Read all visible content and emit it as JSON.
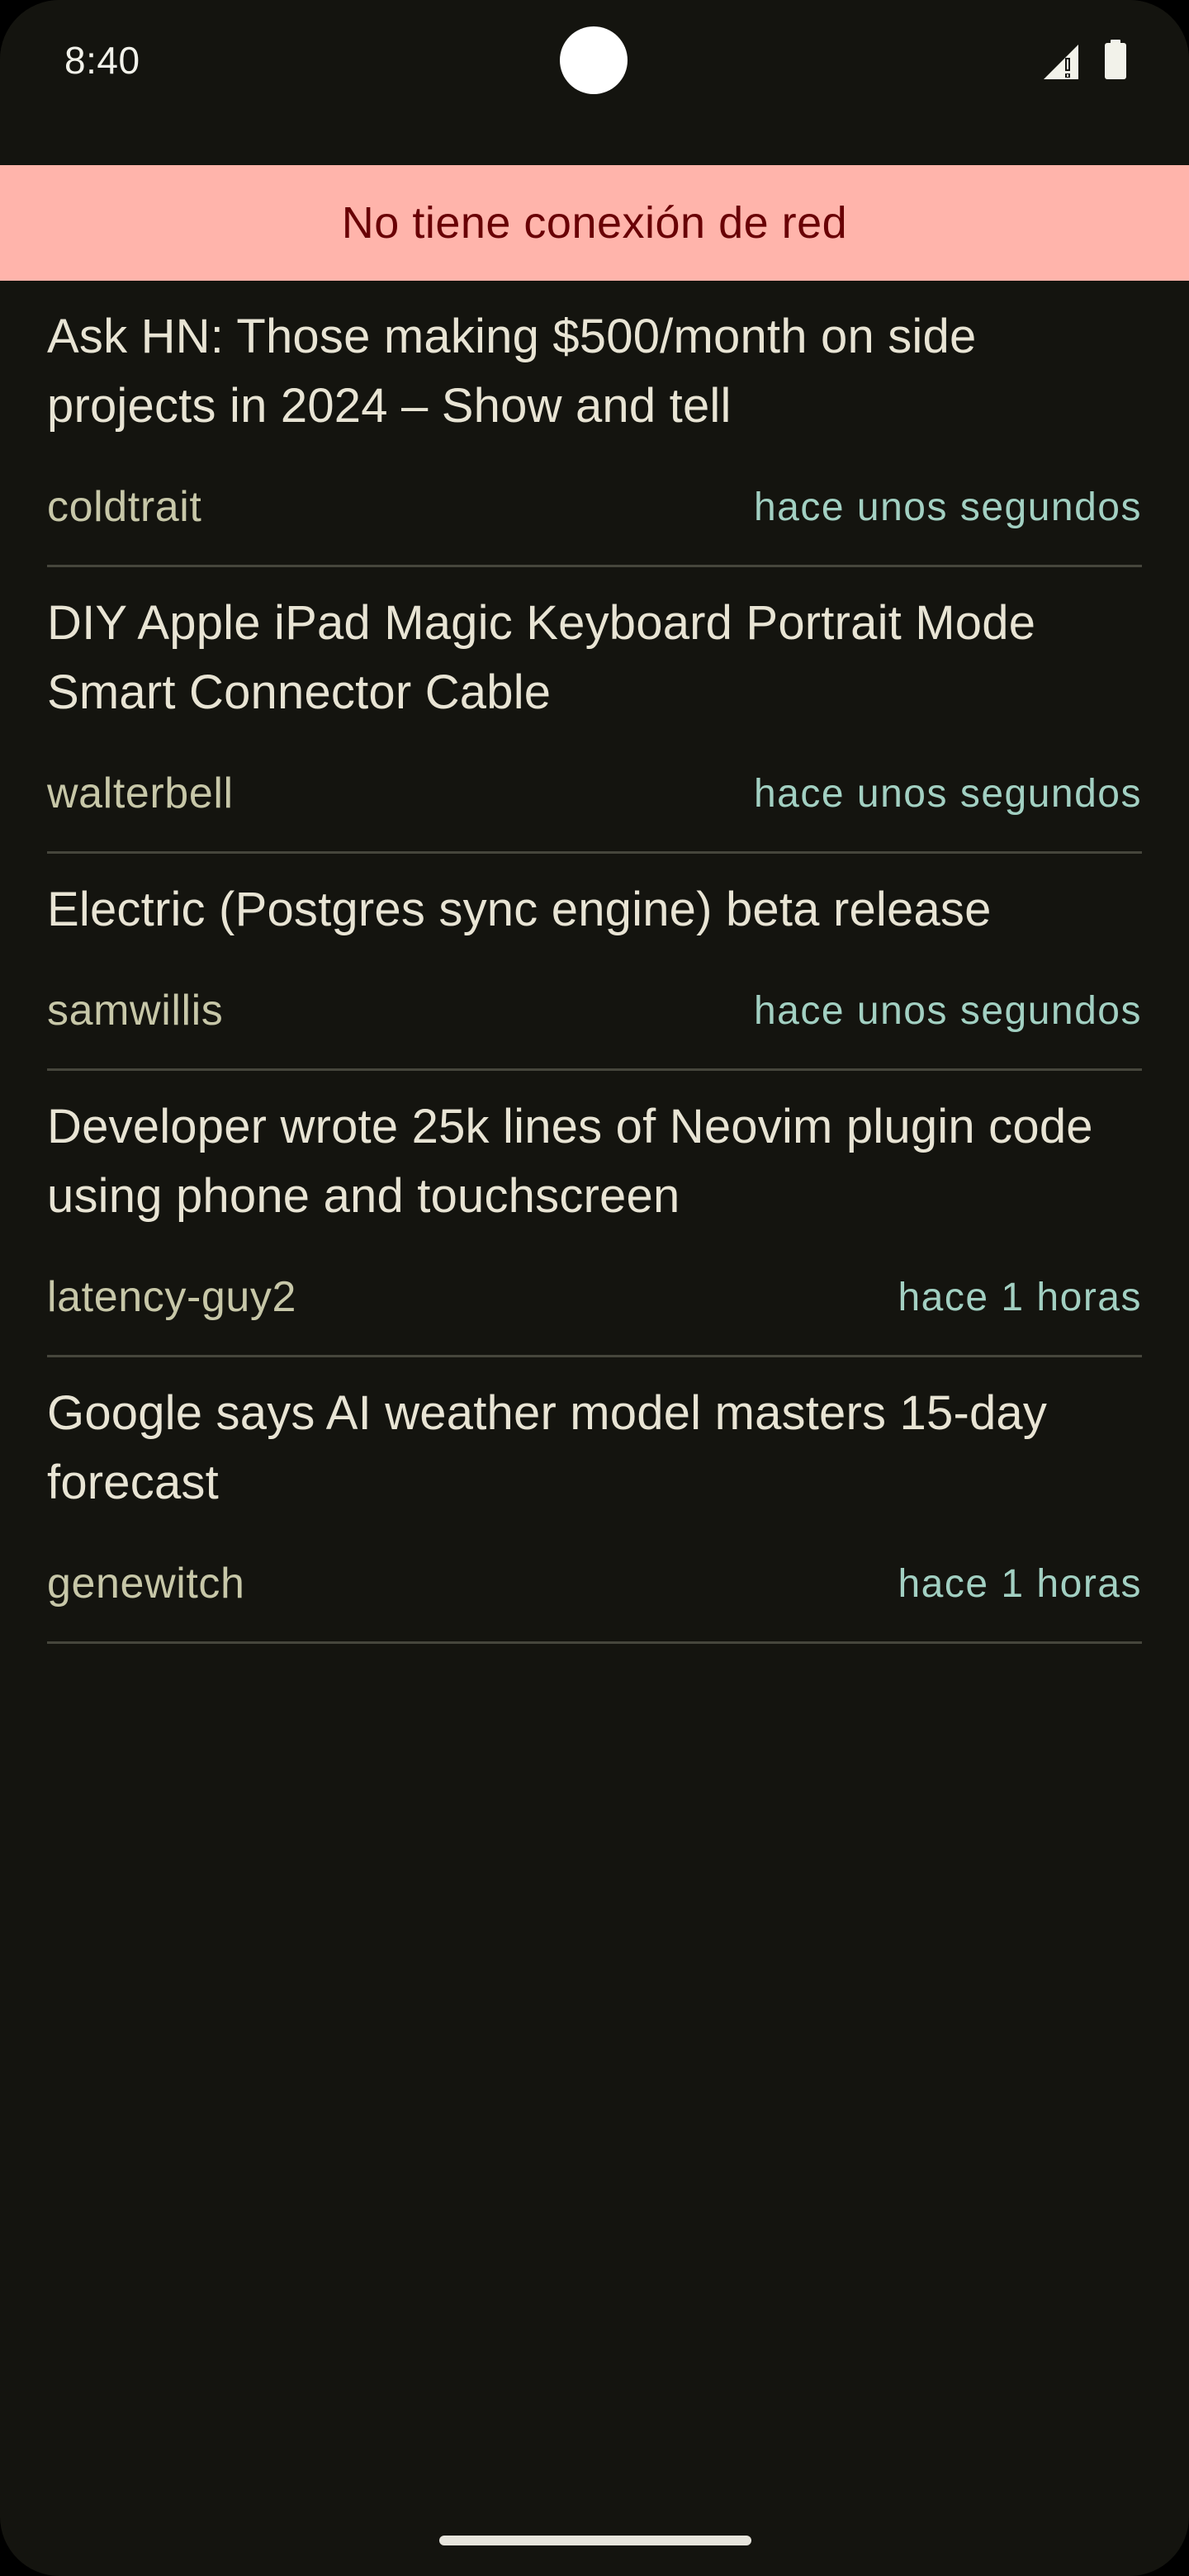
{
  "status_bar": {
    "time": "8:40",
    "icons": [
      "signal-icon",
      "battery-icon"
    ]
  },
  "banner": {
    "text": "No tiene conexión de red",
    "background": "#ffb4ab",
    "text_color": "#690005"
  },
  "stories": [
    {
      "title": "Ask HN: Those making $500/month on side projects in 2024 – Show and tell",
      "author": "coldtrait",
      "time": "hace unos segundos"
    },
    {
      "title": "DIY Apple iPad Magic Keyboard Portrait Mode Smart Connector Cable",
      "author": "walterbell",
      "time": "hace unos segundos"
    },
    {
      "title": "Electric (Postgres sync engine) beta release",
      "author": "samwillis",
      "time": "hace unos segundos"
    },
    {
      "title": "Developer wrote 25k lines of Neovim plugin code using phone and touchscreen",
      "author": "latency-guy2",
      "time": "hace 1 horas"
    },
    {
      "title": "Google says AI weather model masters 15-day forecast",
      "author": "genewitch",
      "time": "hace 1 horas"
    }
  ],
  "colors": {
    "background": "#14140f",
    "title": "#e8e4d4",
    "author": "#c7c7a8",
    "time": "#a2d0c2",
    "divider": "#46463c"
  }
}
